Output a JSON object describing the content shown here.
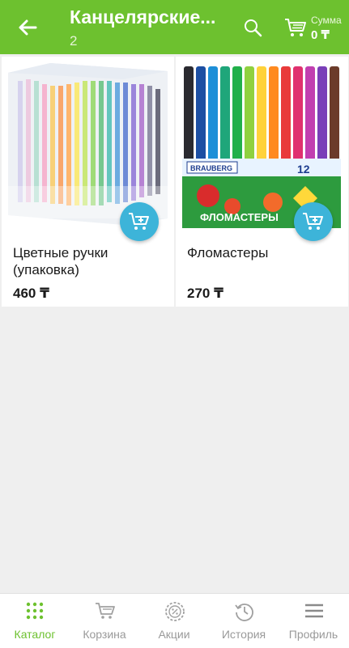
{
  "header": {
    "title": "Канцелярские...",
    "subtitle": "2",
    "sum_label": "Сумма",
    "sum_value": "0 ₸"
  },
  "products": [
    {
      "name": "Цветные ручки (упаковка)",
      "price": "460 ₸"
    },
    {
      "name": "Фломастеры",
      "price": "270 ₸",
      "package_brand": "BRAUBERG",
      "package_label": "ФЛОМАСТЕРЫ",
      "package_count": "12"
    }
  ],
  "nav": {
    "items": [
      {
        "label": "Каталог",
        "icon": "grid-dots-icon",
        "active": true
      },
      {
        "label": "Корзина",
        "icon": "cart-icon",
        "active": false
      },
      {
        "label": "Акции",
        "icon": "discount-badge-icon",
        "active": false
      },
      {
        "label": "История",
        "icon": "history-icon",
        "active": false
      },
      {
        "label": "Профиль",
        "icon": "menu-icon",
        "active": false
      }
    ]
  },
  "colors": {
    "brand_green": "#6dc12f",
    "add_button_blue": "#3db4d9",
    "background": "#efefef"
  }
}
